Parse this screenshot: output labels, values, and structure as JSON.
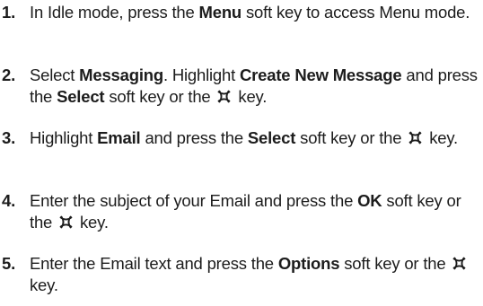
{
  "steps": [
    {
      "number": "1.",
      "t1": "In Idle mode, press the ",
      "b1": "Menu",
      "t2": " soft key to access Menu mode."
    },
    {
      "number": "2.",
      "t1": "Select ",
      "b1": "Messaging",
      "t2": ". Highlight ",
      "b2": "Create New Message",
      "t3": " and press the ",
      "b3": "Select",
      "t4": " soft key or the ",
      "icon": "nav-key-icon",
      "t5": " key."
    },
    {
      "number": "3.",
      "t1": "Highlight ",
      "b1": "Email",
      "t2": " and press the ",
      "b2": "Select",
      "t3": " soft key or the ",
      "icon": "nav-key-icon",
      "t4": " key."
    },
    {
      "number": "4.",
      "t1": "Enter the subject of your Email and press the ",
      "b1": "OK",
      "t2": " soft key or the ",
      "icon": "nav-key-icon",
      "t3": " key."
    },
    {
      "number": "5.",
      "t1": "Enter the Email text and press the ",
      "b1": "Options",
      "t2": " soft key or the ",
      "icon": "nav-key-icon",
      "t3": " key."
    }
  ]
}
